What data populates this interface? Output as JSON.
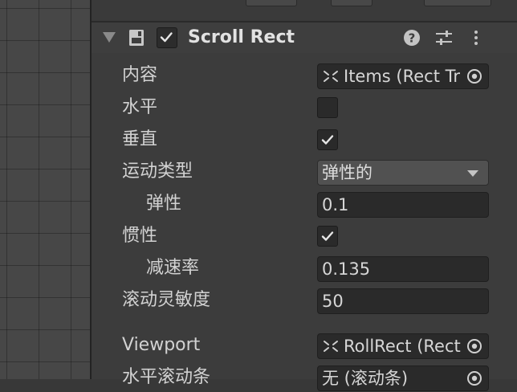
{
  "component": {
    "title": "Scroll Rect",
    "enabled": true
  },
  "properties": {
    "content": {
      "label": "内容",
      "value": "Items (Rect Transform)"
    },
    "horizontal": {
      "label": "水平",
      "checked": false
    },
    "vertical": {
      "label": "垂直",
      "checked": true
    },
    "movement_type": {
      "label": "运动类型",
      "value": "弹性的"
    },
    "elasticity": {
      "label": "弹性",
      "value": "0.1"
    },
    "inertia": {
      "label": "惯性",
      "checked": true
    },
    "deceleration_rate": {
      "label": "减速率",
      "value": "0.135"
    },
    "scroll_sensitivity": {
      "label": "滚动灵敏度",
      "value": "50"
    },
    "viewport": {
      "label": "Viewport",
      "value": "RollRect (Rect Transform)"
    },
    "horizontal_scrollbar": {
      "label": "水平滚动条",
      "value": "无 (滚动条)"
    }
  },
  "icons": {
    "foldout": "triangle-down-icon",
    "component": "scroll-rect-component-icon",
    "help": "help-icon",
    "presets": "sliders-icon",
    "menu": "kebab-menu-icon",
    "object": "rect-transform-icon",
    "picker": "object-picker-icon"
  },
  "colors": {
    "inspector_bg": "#3c3c3c",
    "field_bg": "#2a2a2a",
    "dropdown_bg": "#515151",
    "text": "#d2d2d2"
  }
}
